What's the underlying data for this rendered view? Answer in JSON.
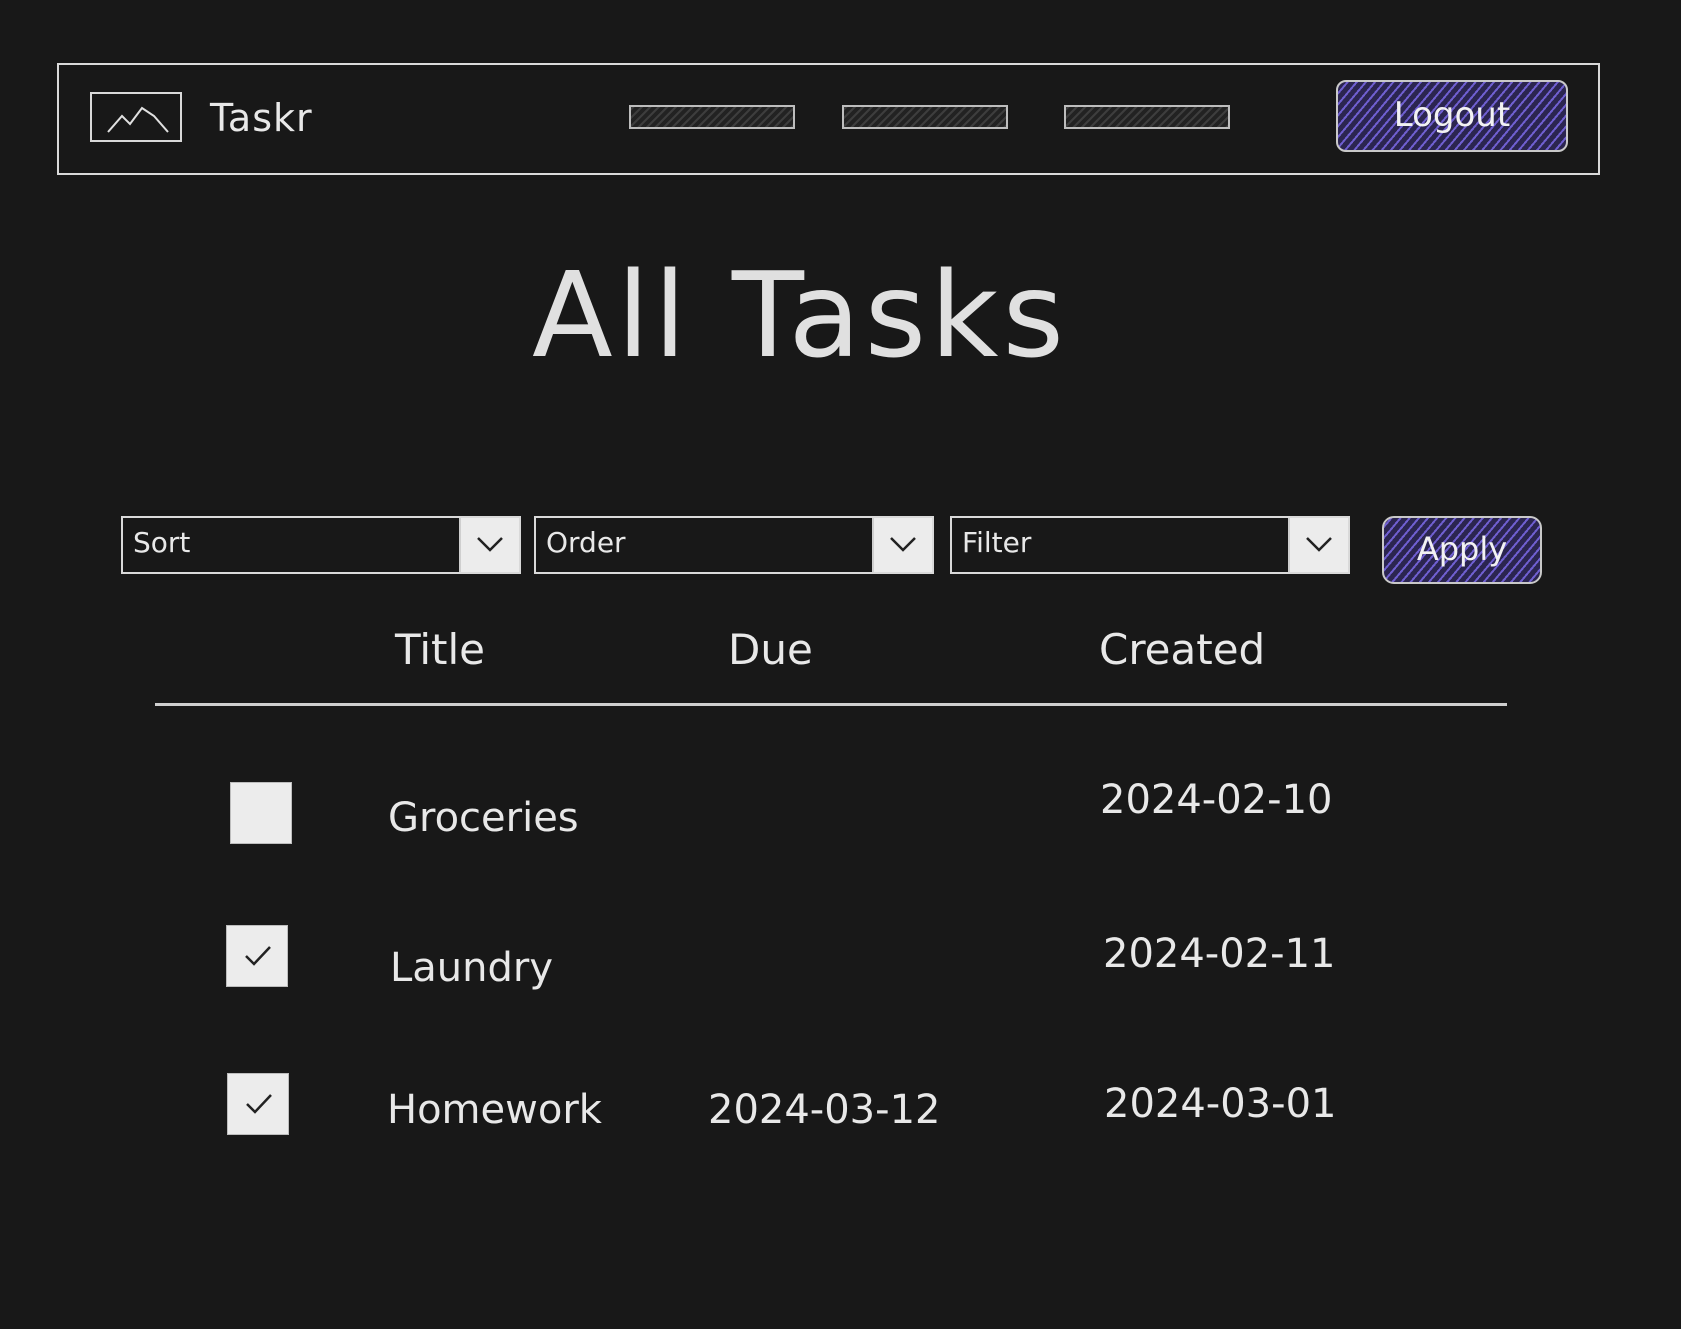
{
  "app": {
    "brand": "Taskr"
  },
  "nav": {
    "links": [
      "",
      "",
      ""
    ],
    "logout_label": "Logout"
  },
  "page": {
    "title": "All Tasks"
  },
  "controls": {
    "sort_label": "Sort",
    "order_label": "Order",
    "filter_label": "Filter",
    "apply_label": "Apply"
  },
  "table": {
    "columns": {
      "title": "Title",
      "due": "Due",
      "created": "Created"
    },
    "rows": [
      {
        "done": false,
        "title": "Groceries",
        "due": "",
        "created": "2024-02-10"
      },
      {
        "done": true,
        "title": "Laundry",
        "due": "",
        "created": "2024-02-11"
      },
      {
        "done": true,
        "title": "Homework",
        "due": "2024-03-12",
        "created": "2024-03-01"
      }
    ]
  },
  "colors": {
    "background": "#181818",
    "accent": "#6f5fd0",
    "foreground": "#e8e8e8"
  }
}
